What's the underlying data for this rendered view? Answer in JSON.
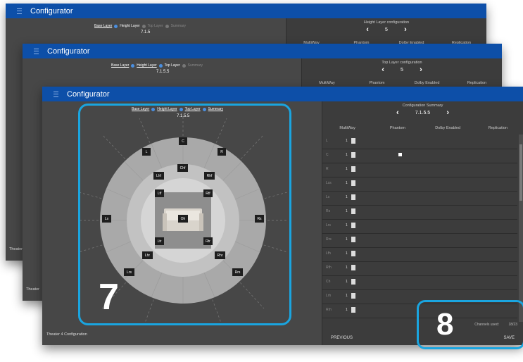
{
  "app_title": "Configurator",
  "wizard_steps": [
    "Base Layer",
    "Height Layer",
    "Top Layer",
    "Summary"
  ],
  "window1": {
    "format": "7.1.5",
    "config_title": "Height Layer configuration",
    "config_value": "5",
    "columns": [
      "MultiWay",
      "Phantom",
      "Dolby Enabled",
      "Replication"
    ],
    "footer_label": "Theater"
  },
  "window2": {
    "format": "7.1.5.5",
    "config_title": "Top Layer configuration",
    "config_value": "5",
    "columns": [
      "MultiWay",
      "Phantom",
      "Dolby Enabled",
      "Replication"
    ],
    "footer_label": "Theater"
  },
  "window3": {
    "format": "7.1.5.5",
    "config_title": "Configuration Summary",
    "config_value": "7.1.5.5",
    "columns": [
      "MultiWay",
      "Phantom",
      "Dolby Enabled",
      "Replication"
    ],
    "footer_label": "Theater 4 Configuration",
    "previous_label": "PREVIOUS",
    "save_label": "SAVE",
    "channels_used_label": "Channels used:",
    "channels_used_value": "18/23",
    "nav_prev": "‹",
    "nav_next": "›",
    "rows": [
      {
        "name": "L",
        "value": "1",
        "phantom": false
      },
      {
        "name": "C",
        "value": "1",
        "phantom": true
      },
      {
        "name": "R",
        "value": "1",
        "phantom": false
      },
      {
        "name": "Lss",
        "value": "1",
        "phantom": false
      },
      {
        "name": "Ls",
        "value": "1",
        "phantom": false
      },
      {
        "name": "Rs",
        "value": "1",
        "phantom": false
      },
      {
        "name": "Lrs",
        "value": "1",
        "phantom": false
      },
      {
        "name": "Rrs",
        "value": "1",
        "phantom": false
      },
      {
        "name": "Lfh",
        "value": "1",
        "phantom": false
      },
      {
        "name": "Rfh",
        "value": "1",
        "phantom": false
      },
      {
        "name": "Ch",
        "value": "1",
        "phantom": false
      },
      {
        "name": "Lrh",
        "value": "1",
        "phantom": false
      },
      {
        "name": "Rrh",
        "value": "1",
        "phantom": false
      }
    ]
  },
  "speakers": [
    "C",
    "L",
    "R",
    "Chf",
    "Lhf",
    "Rhf",
    "Ltf",
    "Rtf",
    "Oh",
    "Ls",
    "Rs",
    "Ltr",
    "Rtr",
    "Lhr",
    "Rhr",
    "Lrs",
    "Rrs"
  ],
  "callouts": {
    "left": "7",
    "right": "8"
  },
  "colors": {
    "titlebar": "#0d4fa8",
    "accent_highlight": "#1aa5e0",
    "step_active": "#4a8fe0"
  }
}
